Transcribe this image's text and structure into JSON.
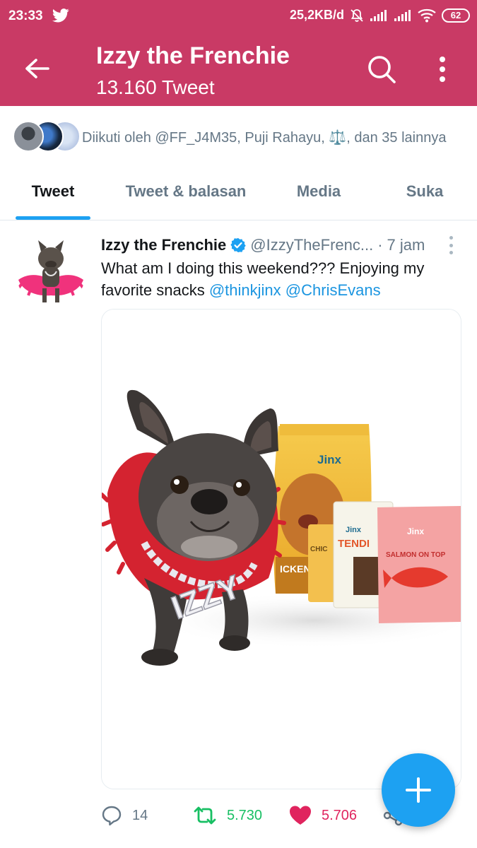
{
  "status_bar": {
    "time": "23:33",
    "net_speed": "25,2KB/d",
    "battery": "62",
    "color": "#c93a65"
  },
  "app_bar": {
    "title": "Izzy the Frenchie",
    "subtitle": "13.160 Tweet",
    "back_icon": "arrow-left-icon",
    "search_icon": "search-icon",
    "more_icon": "more-vertical-icon"
  },
  "followed_by": {
    "text": "Diikuti oleh @FF_J4M35, Puji Rahayu, ⚖️, dan 35 lainnya"
  },
  "tabs": [
    {
      "label": "Tweet",
      "active": true
    },
    {
      "label": "Tweet & balasan",
      "active": false
    },
    {
      "label": "Media",
      "active": false
    },
    {
      "label": "Suka",
      "active": false
    }
  ],
  "tweet": {
    "name": "Izzy the Frenchie",
    "handle": "@IzzyTheFrenc...",
    "separator": "·",
    "time": "7 jam",
    "text": "What am I doing this weekend??? Enjoying my favorite snacks ",
    "mention1": "@thinkjinx",
    "mention2": "@ChrisEvans",
    "media": {
      "brand": "Jinx",
      "bag_text": "ICKEN ET POTA RROT",
      "pack_mid": "TENDI",
      "pack_small": "CHIC",
      "pack_right": "SALMON ON TOP",
      "collar": "IZZY"
    },
    "actions": {
      "replies": "14",
      "retweets": "5.730",
      "likes": "5.706"
    }
  },
  "colors": {
    "accent": "#1da1f2",
    "header": "#c93a65",
    "retweet": "#17bf63",
    "like": "#e0245e",
    "muted": "#657786"
  }
}
